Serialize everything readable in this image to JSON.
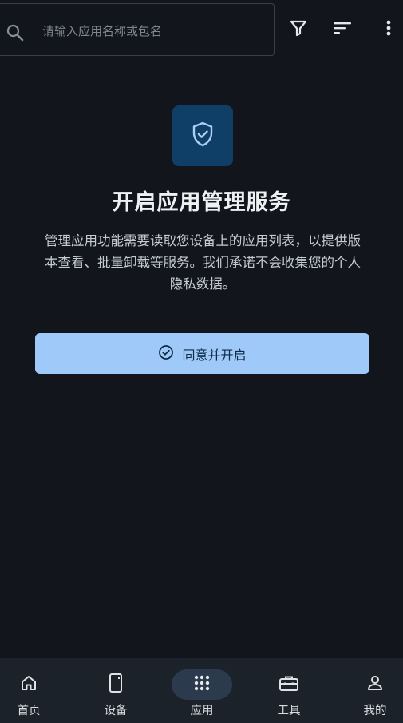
{
  "search": {
    "placeholder": "请输入应用名称或包名"
  },
  "toolbar": {
    "filter_icon": "filter-icon",
    "sort_icon": "sort-icon",
    "more_icon": "more-vert-icon"
  },
  "main": {
    "icon": "shield-check-icon",
    "title": "开启应用管理服务",
    "description": "管理应用功能需要读取您设备上的应用列表，以提供版本查看、批量卸载等服务。我们承诺不会收集您的个人隐私数据。",
    "agree_button_label": "同意并开启"
  },
  "bottom_nav": {
    "items": [
      {
        "label": "首页",
        "icon": "home-icon"
      },
      {
        "label": "设备",
        "icon": "phone-icon"
      },
      {
        "label": "应用",
        "icon": "apps-grid-icon",
        "active": true
      },
      {
        "label": "工具",
        "icon": "toolbox-icon"
      },
      {
        "label": "我的",
        "icon": "person-icon"
      }
    ]
  },
  "colors": {
    "background": "#12161c",
    "accent_button": "#9ec9f9",
    "shield_tile": "#0f3f66",
    "nav_background": "#1c222a"
  }
}
